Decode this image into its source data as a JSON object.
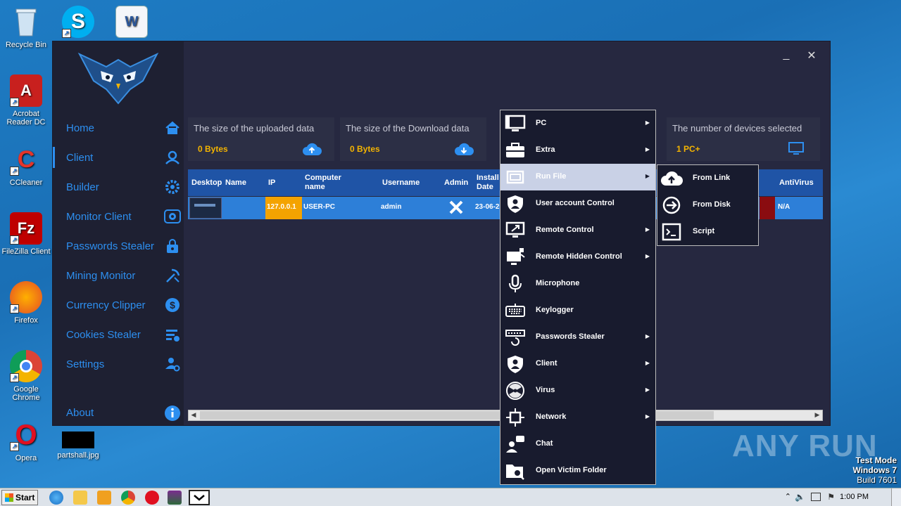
{
  "desktop": {
    "icons": [
      {
        "label": "Recycle Bin"
      },
      {
        "label": "Acrobat Reader DC"
      },
      {
        "label": "CCleaner"
      },
      {
        "label": "FileZilla Client"
      },
      {
        "label": "Firefox"
      },
      {
        "label": "Google Chrome"
      },
      {
        "label": "Opera"
      },
      {
        "label": "partshall.jpg"
      }
    ],
    "watermark": "ANY RUN",
    "test_mode": {
      "line1": "Test Mode",
      "line2": "Windows 7",
      "line3": "Build 7601"
    }
  },
  "app": {
    "window_controls": {
      "minimize": "_",
      "close": "✕"
    },
    "nav": [
      {
        "label": "Home",
        "icon": "home-icon"
      },
      {
        "label": "Client",
        "icon": "user-icon"
      },
      {
        "label": "Builder",
        "icon": "gear-icon"
      },
      {
        "label": "Monitor Client",
        "icon": "eye-icon"
      },
      {
        "label": "Passwords Stealer",
        "icon": "lock-icon"
      },
      {
        "label": "Mining Monitor",
        "icon": "pickaxe-icon"
      },
      {
        "label": "Currency Clipper",
        "icon": "currency-icon"
      },
      {
        "label": "Cookies Stealer",
        "icon": "cookie-list-icon"
      },
      {
        "label": "Settings",
        "icon": "user-settings-icon"
      },
      {
        "label": "About",
        "icon": "info-icon"
      }
    ],
    "cards": [
      {
        "title": "The size of the uploaded data",
        "value": "0 Bytes",
        "icon": "cloud-upload-icon"
      },
      {
        "title": "The size of the Download data",
        "value": "0 Bytes",
        "icon": "cloud-download-icon"
      },
      {
        "title": "The number of devices selected",
        "value": "1 PC+",
        "icon": "monitor-icon"
      }
    ],
    "grid": {
      "headers": [
        "Desktop",
        "Name",
        "IP",
        "Computer name",
        "Username",
        "Admin",
        "Install Date",
        "AntiVirus"
      ],
      "row": {
        "ip": "127.0.0.1",
        "computer_name": "USER-PC",
        "username": "admin",
        "install_date": "23-06-2",
        "antivirus": "N/A"
      }
    }
  },
  "context_menu": {
    "items": [
      {
        "label": "PC",
        "icon": "monitor-icon",
        "submenu": true
      },
      {
        "label": "Extra",
        "icon": "toolbox-icon",
        "submenu": true
      },
      {
        "label": "Run File",
        "icon": "window-run-icon",
        "submenu": true,
        "highlighted": true
      },
      {
        "label": "User account Control",
        "icon": "shield-user-icon",
        "submenu": false
      },
      {
        "label": "Remote Control",
        "icon": "remote-desktop-icon",
        "submenu": true
      },
      {
        "label": "Remote Hidden Control",
        "icon": "hidden-desktop-icon",
        "submenu": true
      },
      {
        "label": "Microphone",
        "icon": "microphone-icon",
        "submenu": false
      },
      {
        "label": "Keylogger",
        "icon": "keyboard-icon",
        "submenu": false
      },
      {
        "label": "Passwords Stealer",
        "icon": "password-refresh-icon",
        "submenu": true
      },
      {
        "label": "Client",
        "icon": "shield-user-icon",
        "submenu": true
      },
      {
        "label": "Virus",
        "icon": "radiation-icon",
        "submenu": true
      },
      {
        "label": "Network",
        "icon": "network-icon",
        "submenu": true
      },
      {
        "label": "Chat",
        "icon": "chat-users-icon",
        "submenu": false
      },
      {
        "label": "Open Victim Folder",
        "icon": "folder-search-icon",
        "submenu": false
      }
    ],
    "run_file_submenu": [
      {
        "label": "From Link",
        "icon": "cloud-upload-icon"
      },
      {
        "label": "From Disk",
        "icon": "arrow-right-circle-icon"
      },
      {
        "label": "Script",
        "icon": "terminal-icon"
      }
    ]
  },
  "taskbar": {
    "start_label": "Start",
    "clock": "1:00 PM"
  }
}
